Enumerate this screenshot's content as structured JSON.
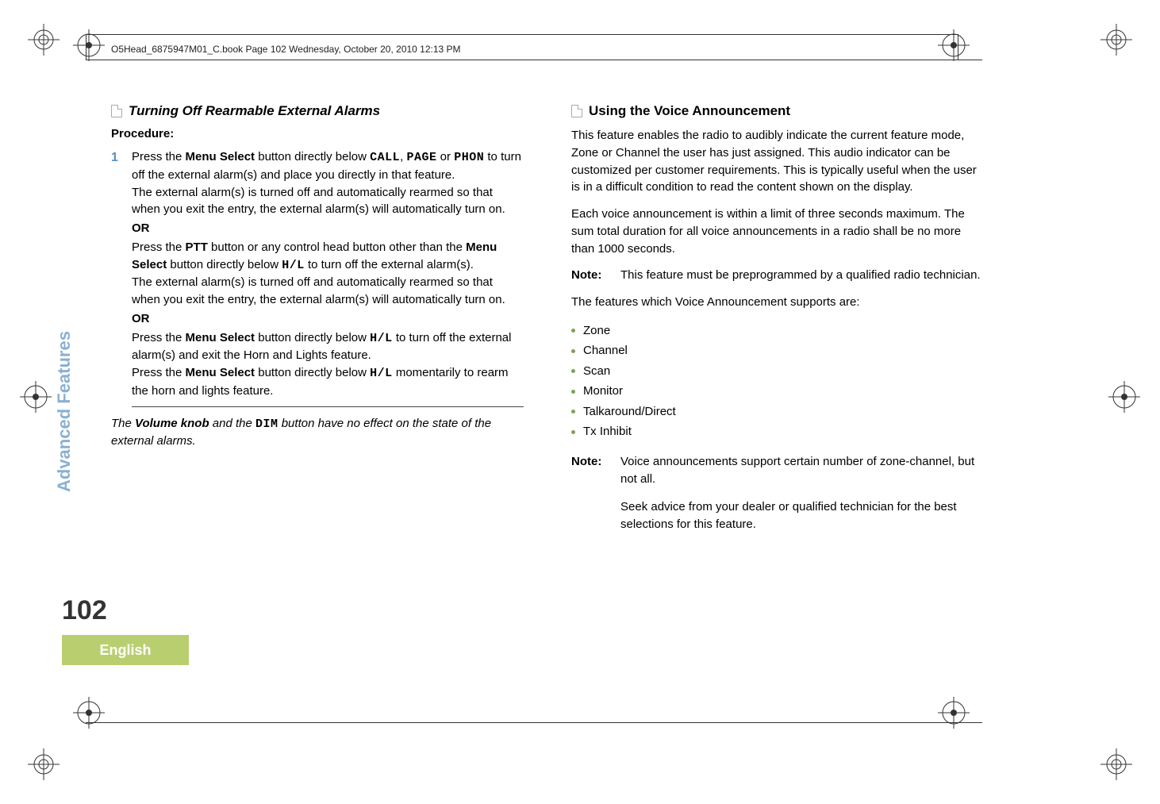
{
  "header": {
    "runhead": "O5Head_6875947M01_C.book  Page 102  Wednesday, October 20, 2010  12:13 PM"
  },
  "sidebar": {
    "section_label": "Advanced Features",
    "page_number": "102",
    "language": "English"
  },
  "left": {
    "title": "Turning Off Rearmable External Alarms",
    "procedure_label": "Procedure:",
    "step_num": "1",
    "s1a": "Press the ",
    "menu_select": "Menu Select",
    "s1b": " button directly below ",
    "code_call": "CALL",
    "comma": ", ",
    "code_page": "PAGE",
    "s1c": " or ",
    "code_phon": "PHON",
    "s1d": " to turn off the external alarm(s) and place you directly in that feature.",
    "s1e": "The external alarm(s) is turned off and automatically rearmed so that when you exit the entry, the external alarm(s) will automatically turn on.",
    "or": "OR",
    "s2a": "Press the ",
    "ptt": "PTT",
    "s2b": " button or any control head button other than the ",
    "s2c": " button directly below ",
    "code_hl": "H/L",
    "s2d": " to turn off the external alarm(s).",
    "s2e": "The external alarm(s) is turned off and automatically rearmed so that when you exit the entry, the external alarm(s) will automatically turn on.",
    "s3a": "Press the ",
    "s3c": " to turn off the external alarm(s) and exit the Horn and Lights feature.",
    "s3d": "Press the ",
    "s3f": " momentarily to rearm the horn and lights feature.",
    "foot_a": "The ",
    "vol_knob": "Volume knob",
    "foot_b": " and the ",
    "code_dim": "DIM",
    "foot_c": " button have no effect on the state of the external alarms."
  },
  "right": {
    "title": "Using the Voice Announcement",
    "p1": "This feature enables the radio to audibly indicate the current feature mode, Zone or Channel the user has just assigned. This audio indicator can be customized per customer requirements. This is typically useful when the user is in a difficult condition to read the content shown on the display.",
    "p2": "Each voice announcement is within a limit of three seconds maximum. The sum total duration for all voice announcements in a radio shall be no more than 1000 seconds.",
    "note_label": "Note:",
    "note1": "This feature must be preprogrammed by a qualified radio technician.",
    "p3": "The features which Voice Announcement supports are:",
    "bullets": {
      "b0": "Zone",
      "b1": "Channel",
      "b2": "Scan",
      "b3": "Monitor",
      "b4": "Talkaround/Direct",
      "b5": "Tx Inhibit"
    },
    "note2a": "Voice announcements support certain number of zone-channel, but not all.",
    "note2b": "Seek advice from your dealer or qualified technician for the best selections for this feature."
  }
}
